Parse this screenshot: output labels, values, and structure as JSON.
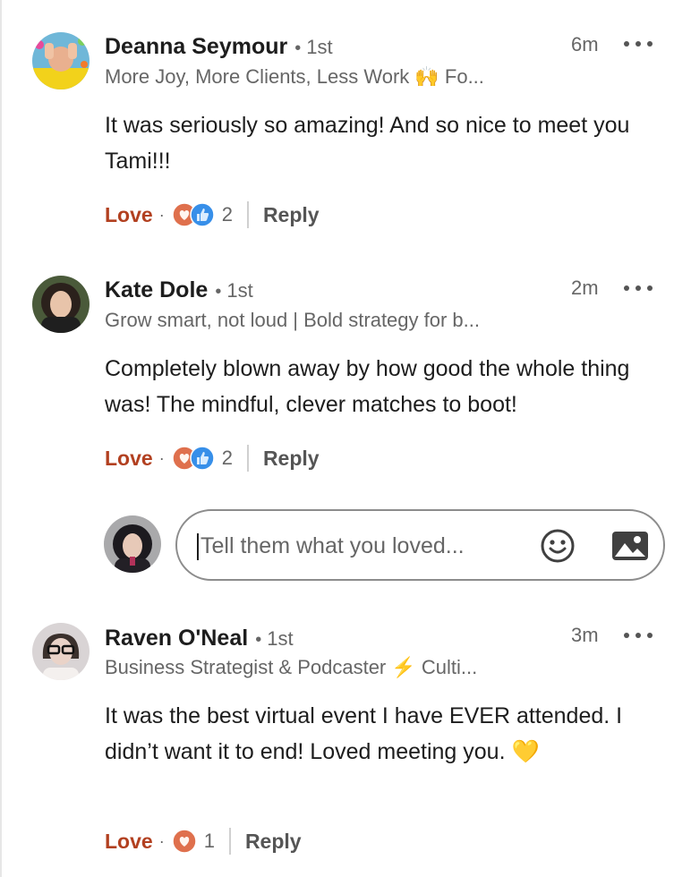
{
  "comments": [
    {
      "name": "Deanna Seymour",
      "degree": "1st",
      "headline": "More Joy, More Clients, Less Work 🙌 Fo...",
      "time": "6m",
      "text": "It was seriously so amazing! And so nice to meet you Tami!!!",
      "love_label": "Love",
      "reaction_count": "2",
      "reply_label": "Reply",
      "reactions": [
        "love-reaction-icon",
        "like-reaction-icon"
      ]
    },
    {
      "name": "Kate Dole",
      "degree": "1st",
      "headline": "Grow smart, not loud | Bold strategy for b...",
      "time": "2m",
      "text": "Completely blown away by how good the whole thing was! The mindful, clever matches to boot!",
      "love_label": "Love",
      "reaction_count": "2",
      "reply_label": "Reply",
      "reactions": [
        "love-reaction-icon",
        "like-reaction-icon"
      ]
    },
    {
      "name": "Raven O'Neal",
      "degree": "1st",
      "headline": "Business Strategist & Podcaster ⚡ Culti...",
      "time": "3m",
      "text": "It was the best virtual event I have EVER attended. I didn’t want it to end! Loved meeting you. 💛",
      "love_label": "Love",
      "reaction_count": "1",
      "reply_label": "Reply",
      "reactions": [
        "love-reaction-icon"
      ]
    }
  ],
  "composer": {
    "placeholder": "Tell them what you loved...",
    "icons": [
      "emoji-icon",
      "image-icon"
    ]
  },
  "colors": {
    "love": "#b24020",
    "like": "#378fe9",
    "love_reaction": "#df704d",
    "muted": "#666666"
  }
}
